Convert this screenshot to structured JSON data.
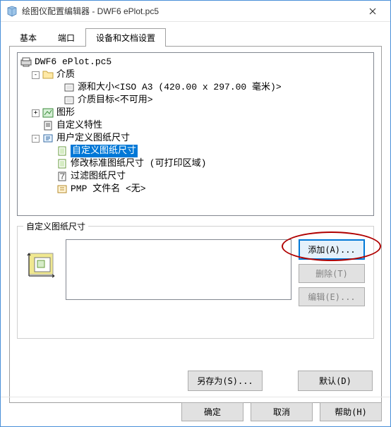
{
  "titlebar": {
    "title": "绘图仪配置编辑器 - DWF6 ePlot.pc5"
  },
  "tabs": {
    "t0": "基本",
    "t1": "端口",
    "t2": "设备和文档设置"
  },
  "tree": {
    "root": "DWF6 ePlot.pc5",
    "media": "介质",
    "media_src": "源和大小<ISO A3 (420.00 x 297.00 毫米)>",
    "media_dst": "介质目标<不可用>",
    "graphic": "图形",
    "custom_prop": "自定义特性",
    "user_paper": "用户定义图纸尺寸",
    "custom_paper": "自定义图纸尺寸",
    "modify_std": "修改标准图纸尺寸 (可打印区域)",
    "filter_paper": "过滤图纸尺寸",
    "pmp": "PMP 文件名 <无>"
  },
  "group": {
    "label": "自定义图纸尺寸",
    "add": "添加(A)...",
    "delete": "删除(T)",
    "edit": "编辑(E)..."
  },
  "bottom": {
    "saveas": "另存为(S)...",
    "default": "默认(D)"
  },
  "dialog": {
    "ok": "确定",
    "cancel": "取消",
    "help": "帮助(H)"
  }
}
